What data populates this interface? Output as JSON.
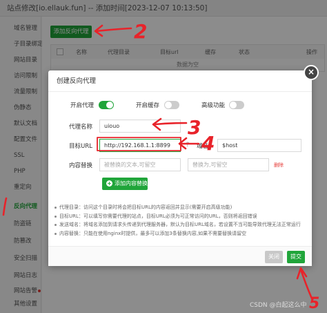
{
  "window": {
    "title": "站点修改[io.ellauk.fun] -- 添加时间[2023-12-07 10:13:50]"
  },
  "sidebar": {
    "items": [
      {
        "label": "域名管理"
      },
      {
        "label": "子目录绑定"
      },
      {
        "label": "网站目录"
      },
      {
        "label": "访问限制"
      },
      {
        "label": "流量限制"
      },
      {
        "label": "伪静态"
      },
      {
        "label": "默认文档"
      },
      {
        "label": "配置文件"
      },
      {
        "label": "SSL"
      },
      {
        "label": "PHP"
      },
      {
        "label": "重定向"
      },
      {
        "label": "反向代理"
      },
      {
        "label": "防盗链"
      },
      {
        "label": "防篡改"
      },
      {
        "label": "安全扫描"
      },
      {
        "label": "网站日志"
      },
      {
        "label": "网站告警"
      },
      {
        "label": "其他设置"
      }
    ]
  },
  "proxy_list": {
    "add_button": "添加反向代理",
    "columns": [
      "名称",
      "代理目录",
      "目标url",
      "缓存",
      "状态",
      "操作"
    ],
    "empty_text": "数据为空"
  },
  "modal": {
    "title": "创建反向代理",
    "close": "×",
    "toggles": {
      "enable_proxy": {
        "label": "开启代理",
        "on": true
      },
      "enable_cache": {
        "label": "开启缓存",
        "on": false
      },
      "advanced": {
        "label": "高级功能",
        "on": false
      }
    },
    "form": {
      "name_label": "代理名称",
      "name_value": "uiouo",
      "target_url_label": "目标URL",
      "target_url_value": "http://192.168.1.1:8899",
      "send_domain_label": "域名",
      "send_domain_value": "$host",
      "replace_label": "内容替换",
      "replace_from_placeholder": "被替换的文本,可留空",
      "replace_to_placeholder": "替换为,可留空",
      "delete_link": "删除",
      "add_replace_button": "添加内容替换"
    },
    "notes": [
      "代理目录：访问这个目录时将会把目标URL的内容返回并显示(需要开启高级功能)",
      "目标URL：可以填写你需要代理的站点，目标URL必须为可正常访问的URL，否则将返回错误",
      "发送域名：将域名添加到请求头传递到代理服务器，默认为目标URL域名，若设置不当可能导致代理无法正常运行",
      "内容替换：只能在使用nginx时提供，最多可以添加3条替换内容,如果不需要替换请留空"
    ],
    "buttons": {
      "close": "关闭",
      "submit": "提交"
    }
  },
  "annotations": {
    "numbers": [
      "2",
      "1",
      "3",
      "4",
      "5"
    ],
    "color": "#e8232a"
  },
  "watermark": "CSDN @白起这么中",
  "colors": {
    "accent": "#20a53a",
    "danger": "#e53935"
  }
}
